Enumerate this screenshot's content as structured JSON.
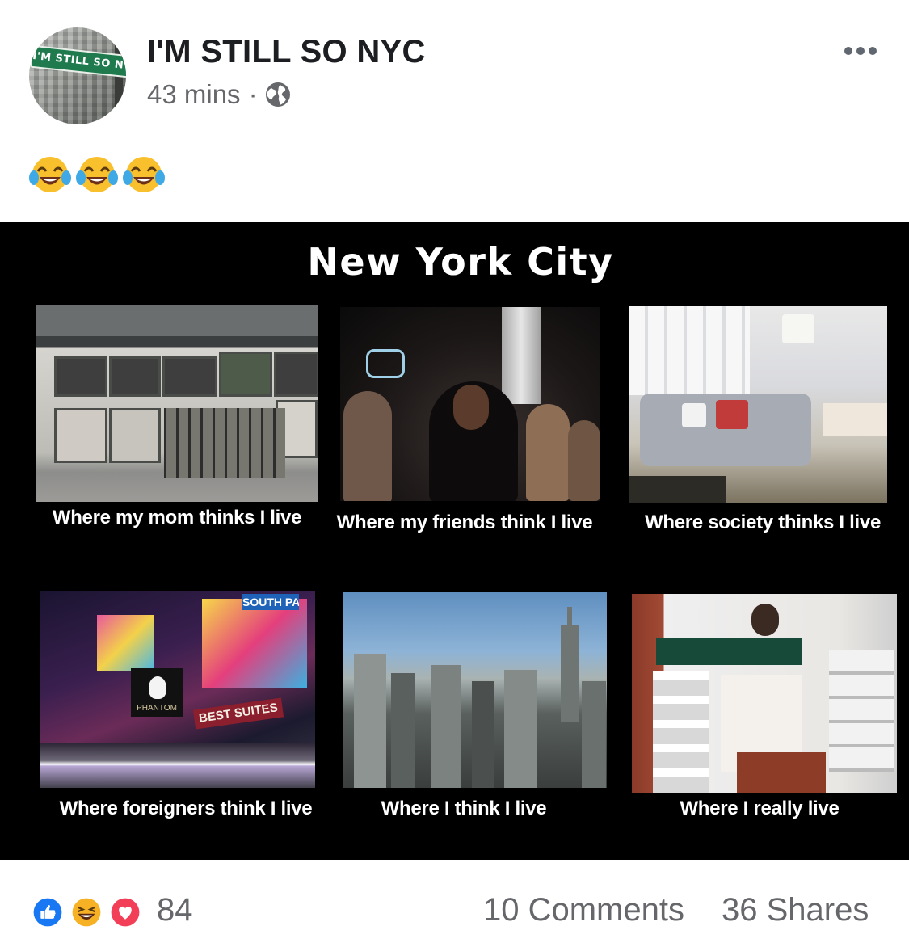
{
  "post": {
    "page_name": "I'M STILL SO NYC",
    "avatar_sign_text": "I'M STILL SO NYC",
    "time": "43 mins",
    "separator": "·",
    "privacy_icon": "globe-icon",
    "more_icon": "more-options-icon",
    "status_emojis": [
      "face-with-tears-of-joy",
      "face-with-tears-of-joy",
      "face-with-tears-of-joy"
    ]
  },
  "meme": {
    "title": "New York City",
    "panels": [
      {
        "caption": "Where my mom thinks I live"
      },
      {
        "caption": "Where my friends think I live"
      },
      {
        "caption": "Where society thinks I live"
      },
      {
        "caption": "Where foreigners think I live"
      },
      {
        "caption": "Where I think I live"
      },
      {
        "caption": "Where I really live"
      }
    ],
    "signage": {
      "phantom": "PHANTOM",
      "best_suites": "BEST SUITES",
      "south_pacific": "SOUTH PACIFIC"
    }
  },
  "footer": {
    "reactions": [
      "like-icon",
      "haha-icon",
      "love-icon"
    ],
    "reaction_count": "84",
    "comments": "10 Comments",
    "shares": "36 Shares"
  },
  "colors": {
    "text_primary": "#1c1e21",
    "text_secondary": "#65676b",
    "meme_background": "#000000",
    "like_blue": "#1877f2",
    "love_red": "#f33e58",
    "haha_yellow": "#f7b125"
  }
}
